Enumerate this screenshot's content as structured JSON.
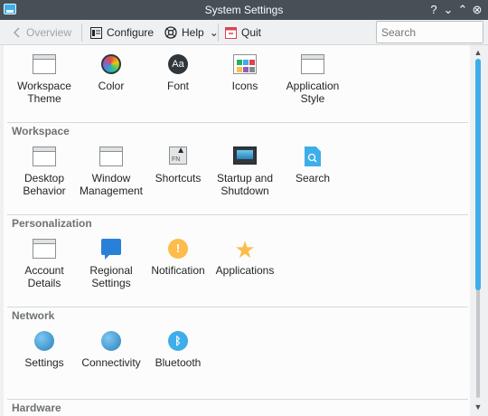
{
  "window": {
    "title": "System Settings"
  },
  "toolbar": {
    "overview_label": "Overview",
    "configure_label": "Configure",
    "help_label": "Help",
    "help_arrow": "⌄",
    "quit_label": "Quit"
  },
  "search": {
    "placeholder": "Search",
    "value": ""
  },
  "appearance_items": [
    {
      "label": "Workspace Theme",
      "icon": "window-icon"
    },
    {
      "label": "Color",
      "icon": "color-wheel-icon"
    },
    {
      "label": "Font",
      "icon": "font-icon",
      "glyph": "Aa"
    },
    {
      "label": "Icons",
      "icon": "icons-icon"
    },
    {
      "label": "Application Style",
      "icon": "window-icon"
    }
  ],
  "sections": [
    {
      "title": "Workspace",
      "items": [
        {
          "label": "Desktop Behavior",
          "icon": "window-icon"
        },
        {
          "label": "Window Management",
          "icon": "window-icon"
        },
        {
          "label": "Shortcuts",
          "icon": "keyboard-icon",
          "glyph": "FN"
        },
        {
          "label": "Startup and Shutdown",
          "icon": "monitor-icon"
        },
        {
          "label": "Search",
          "icon": "search-icon"
        }
      ]
    },
    {
      "title": "Personalization",
      "items": [
        {
          "label": "Account Details",
          "icon": "window-icon"
        },
        {
          "label": "Regional Settings",
          "icon": "speech-bubble-icon"
        },
        {
          "label": "Notification",
          "icon": "notification-icon",
          "glyph": "!"
        },
        {
          "label": "Applications",
          "icon": "star-icon",
          "glyph": "★"
        }
      ]
    },
    {
      "title": "Network",
      "items": [
        {
          "label": "Settings",
          "icon": "globe-icon"
        },
        {
          "label": "Connectivity",
          "icon": "globe-icon"
        },
        {
          "label": "Bluetooth",
          "icon": "bluetooth-icon",
          "glyph": "ᛒ"
        }
      ]
    },
    {
      "title": "Hardware",
      "items": []
    }
  ],
  "colors": {
    "accent": "#3daee9",
    "titlebar": "#475057",
    "window_bg": "#eff0f1",
    "content_bg": "#fcfcfc"
  }
}
